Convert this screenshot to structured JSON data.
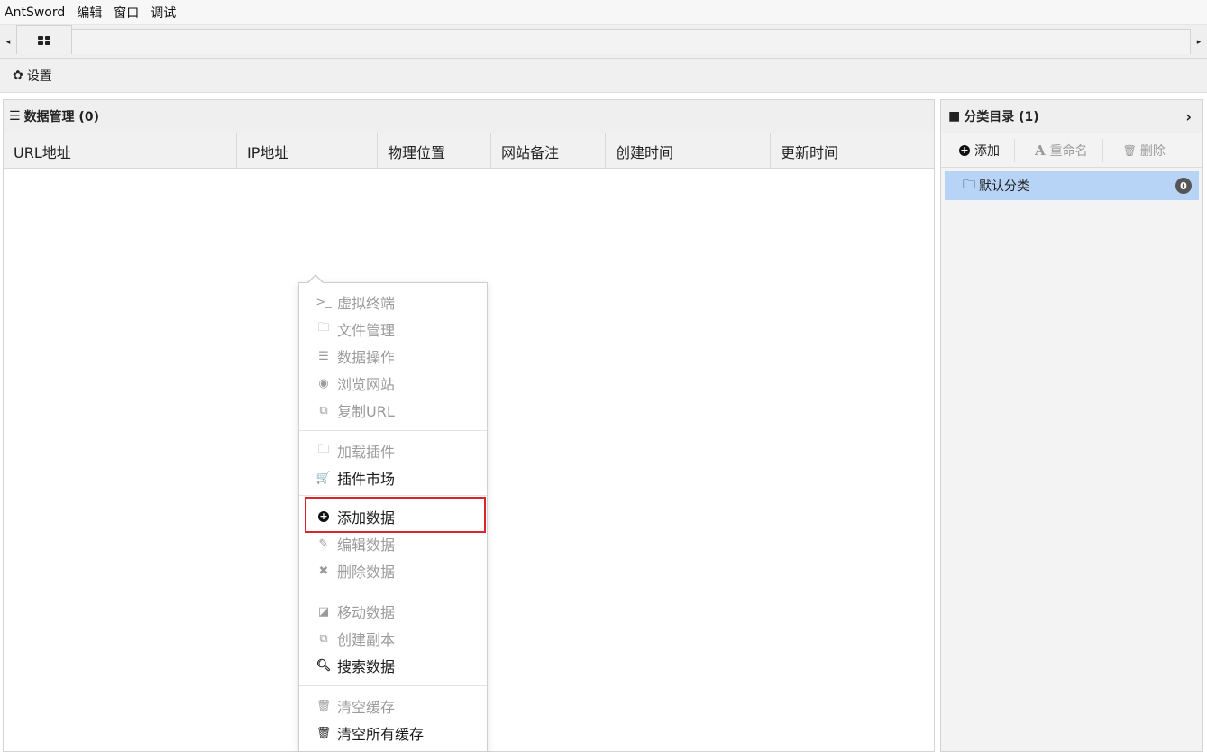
{
  "menubar": {
    "items": [
      "AntSword",
      "编辑",
      "窗口",
      "调试"
    ]
  },
  "tabbar": {
    "left_arrow": "◂",
    "right_arrow": "▸",
    "active_tab_icon": "grid-icon"
  },
  "toolbar": {
    "settings_icon": "gear-icon",
    "settings_label": "设置"
  },
  "data_panel": {
    "title": "数据管理 (0)",
    "icon": "list-icon",
    "columns": [
      "URL地址",
      "IP地址",
      "物理位置",
      "网站备注",
      "创建时间",
      "更新时间"
    ]
  },
  "category_panel": {
    "title": "分类目录 (1)",
    "icon": "folder-icon",
    "add_label": "添加",
    "rename_label": "重命名",
    "delete_label": "删除",
    "items": [
      {
        "label": "默认分类",
        "count": "0"
      }
    ]
  },
  "context_menu": {
    "items": [
      {
        "label": "虚拟终端",
        "icon": "terminal-icon",
        "enabled": false
      },
      {
        "label": "文件管理",
        "icon": "folder-icon",
        "enabled": false
      },
      {
        "label": "数据操作",
        "icon": "database-icon",
        "enabled": false
      },
      {
        "label": "浏览网站",
        "icon": "chrome-icon",
        "enabled": false
      },
      {
        "label": "复制URL",
        "icon": "copy-icon",
        "enabled": false
      },
      {
        "label": "加载插件",
        "icon": "folder-icon",
        "enabled": false
      },
      {
        "label": "插件市场",
        "icon": "cart-icon",
        "enabled": true
      },
      {
        "label": "添加数据",
        "icon": "plus-circle-icon",
        "enabled": true
      },
      {
        "label": "编辑数据",
        "icon": "edit-icon",
        "enabled": false
      },
      {
        "label": "删除数据",
        "icon": "close-icon",
        "enabled": false
      },
      {
        "label": "移动数据",
        "icon": "move-icon",
        "enabled": false
      },
      {
        "label": "创建副本",
        "icon": "copy-icon",
        "enabled": false
      },
      {
        "label": "搜索数据",
        "icon": "search-icon",
        "enabled": true
      },
      {
        "label": "清空缓存",
        "icon": "trash-icon",
        "enabled": false
      },
      {
        "label": "清空所有缓存",
        "icon": "trash-icon",
        "enabled": true
      }
    ]
  },
  "colors": {
    "highlight_border": "#d9262c",
    "selected_category": "#b7d3f5"
  }
}
